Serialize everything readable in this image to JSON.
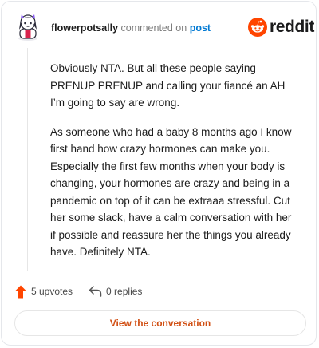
{
  "header": {
    "username": "flowerpotsally",
    "action_text": "commented on",
    "target_link": "post",
    "logo_text": "reddit"
  },
  "comment": {
    "paragraphs": [
      "Obviously NTA. But all these people saying PRENUP PRENUP and calling your fiancé an AH I’m going to say are wrong.",
      "As someone who had a baby 8 months ago I know first hand how crazy hormones can make you. Especially the first few months when your body is changing, your hormones are crazy and being in a pandemic on top of it can be extraaa stressful. Cut her some slack, have a calm conversation with her if possible and reassure her the things you already have. Definitely NTA."
    ]
  },
  "footer": {
    "upvotes_label": "5 upvotes",
    "replies_label": "0 replies",
    "view_button_label": "View the conversation"
  },
  "icons": {
    "upvote": "upvote-arrow-icon",
    "reply": "reply-arrow-icon",
    "logo": "reddit-snoo-icon"
  },
  "colors": {
    "accent": "#ff4500",
    "link": "#0079d3",
    "button_text": "#d14f13"
  }
}
